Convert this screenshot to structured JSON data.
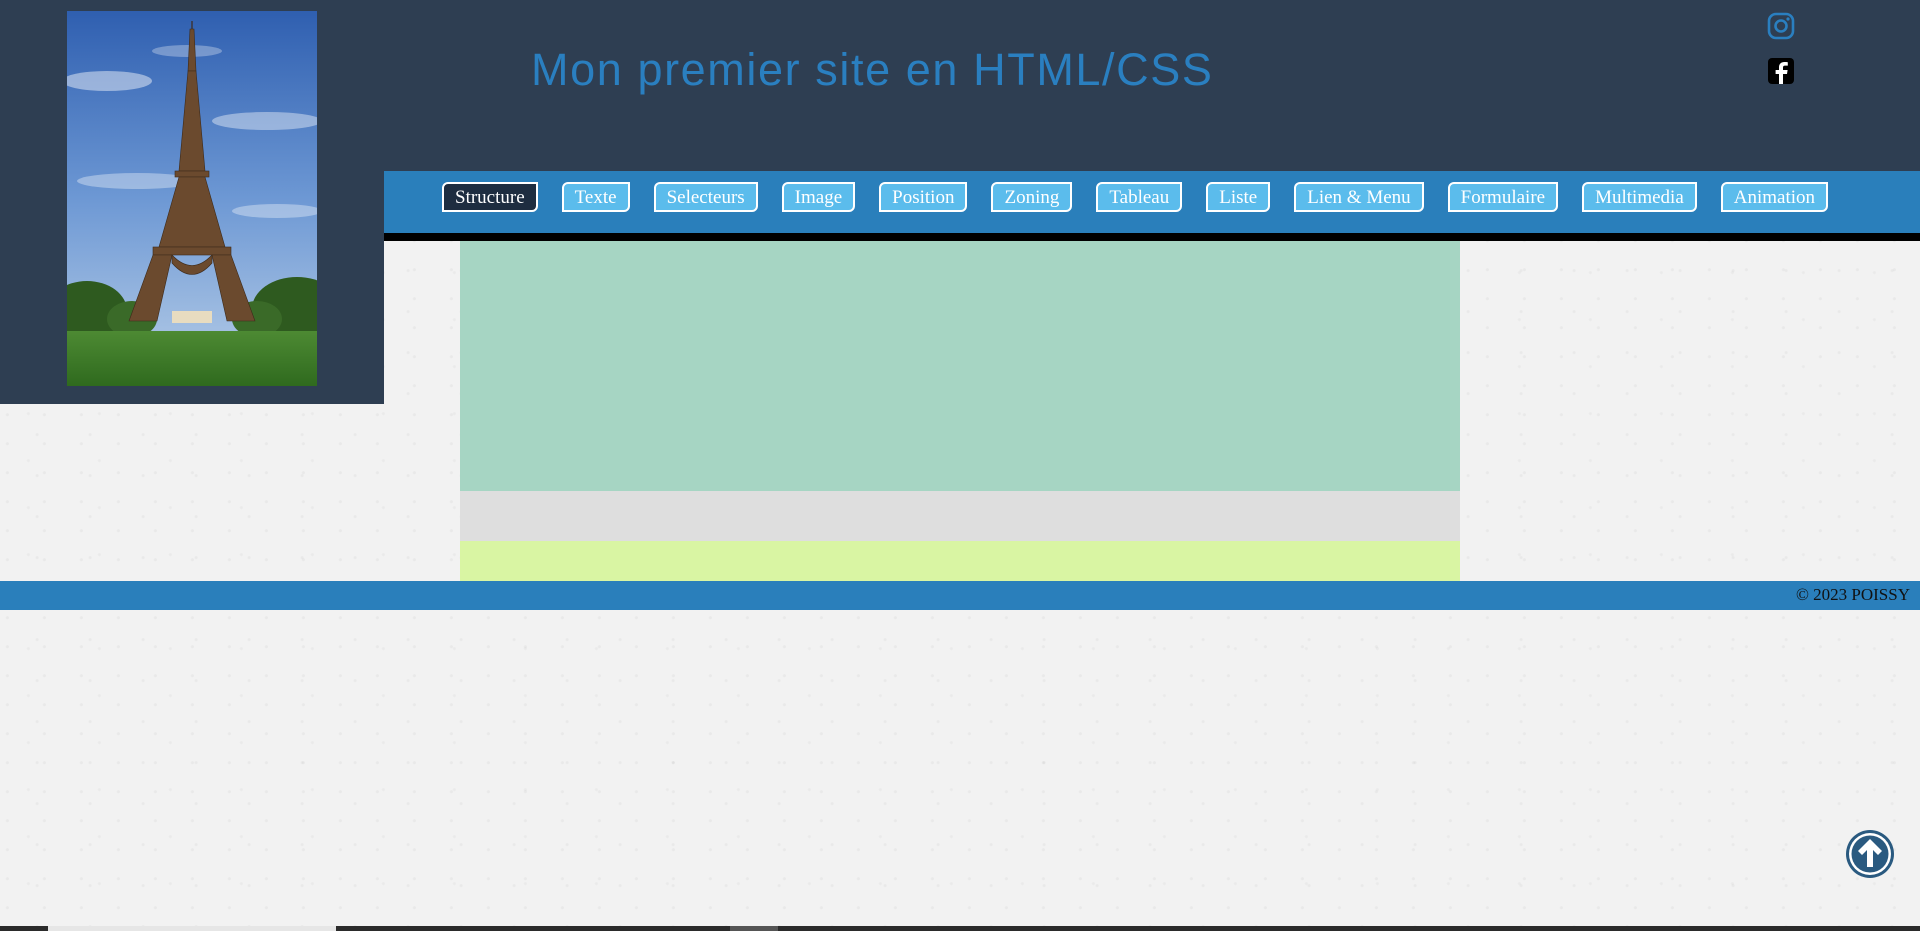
{
  "header": {
    "title": "Mon premier site en HTML/CSS",
    "logo_image": "eiffel-tower-photo"
  },
  "social": {
    "instagram_icon": "instagram-icon",
    "facebook_icon": "facebook-icon"
  },
  "nav": {
    "items": [
      {
        "label": "Structure",
        "active": true
      },
      {
        "label": "Texte",
        "active": false
      },
      {
        "label": "Selecteurs",
        "active": false
      },
      {
        "label": "Image",
        "active": false
      },
      {
        "label": "Position",
        "active": false
      },
      {
        "label": "Zoning",
        "active": false
      },
      {
        "label": "Tableau",
        "active": false
      },
      {
        "label": "Liste",
        "active": false
      },
      {
        "label": "Lien & Menu",
        "active": false
      },
      {
        "label": "Formulaire",
        "active": false
      },
      {
        "label": "Multimedia",
        "active": false
      },
      {
        "label": "Animation",
        "active": false
      }
    ]
  },
  "footer": {
    "copyright": "© 2023 POISSY"
  },
  "back_to_top": {
    "icon": "arrow-up-circle-icon"
  },
  "colors": {
    "header_bg": "#2e3e52",
    "title": "#2a7fc0",
    "nav_bg": "#2a7fbb",
    "nav_button": "#5bbcec",
    "nav_button_active": "#1e2d40",
    "section_1": "#a6d5c3",
    "section_2": "#dedede",
    "section_3": "#d9f5a3",
    "footer_bg": "#2a7fbb",
    "back_to_top": "#2a5a80"
  }
}
